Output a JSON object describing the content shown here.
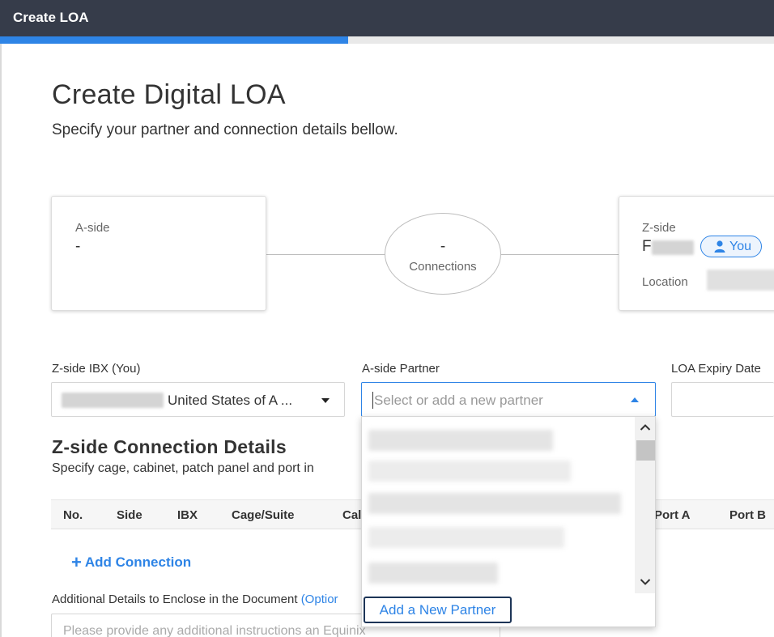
{
  "window": {
    "title": "Create LOA"
  },
  "progress": {
    "percent": 45
  },
  "page": {
    "title": "Create Digital LOA",
    "subtitle": "Specify your partner and connection details bellow."
  },
  "summary": {
    "a_side": {
      "label": "A-side",
      "value": "-"
    },
    "connections": {
      "count": "-",
      "label": "Connections"
    },
    "z_side": {
      "label": "Z-side",
      "name_initial": "F",
      "badge": "You",
      "location_label": "Location"
    }
  },
  "form": {
    "z_ibx": {
      "label": "Z-side IBX (You)",
      "value": "United States of A ..."
    },
    "a_partner": {
      "label": "A-side Partner",
      "placeholder": "Select or add a new partner"
    },
    "loa_expiry": {
      "label": "LOA Expiry Date"
    }
  },
  "details_section": {
    "title": "Z-side Connection Details",
    "subtitle": "Specify cage, cabinet, patch panel and port in"
  },
  "table": {
    "columns": [
      "No.",
      "Side",
      "IBX",
      "Cage/Suite",
      "Cal",
      "Port A",
      "Port B"
    ]
  },
  "actions": {
    "add_connection": "Add Connection"
  },
  "additional": {
    "label": "Additional Details to Enclose in the Document",
    "optional": "(Optior",
    "placeholder": "Please provide any additional instructions an Equinix"
  },
  "dropdown": {
    "add_partner": "Add a New Partner"
  },
  "colors": {
    "accent": "#2e84e6",
    "topbar": "#363c4a",
    "focus_border": "#1d3557"
  },
  "icons": [
    "user-icon",
    "caret-down-icon",
    "caret-up-icon",
    "chevron-up-icon",
    "chevron-down-icon",
    "plus-icon"
  ]
}
